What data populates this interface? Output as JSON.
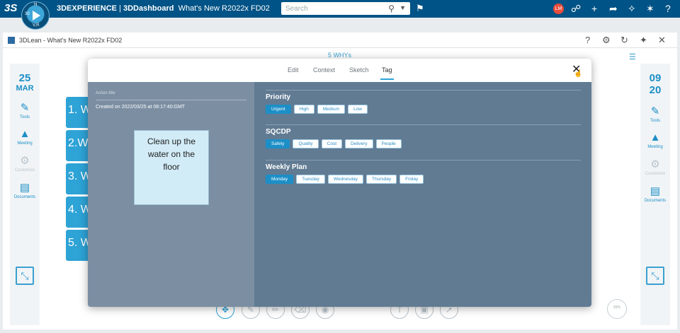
{
  "topbar": {
    "logo": "3S",
    "compass": {
      "north": "N",
      "left": "30",
      "vr": "V,R"
    },
    "app_name": "3DEXPERIENCE",
    "dashboard": "3DDashboard",
    "dashboard_title": "What's New R2022x FD02",
    "search_placeholder": "Search",
    "avatar": "LM"
  },
  "widget": {
    "title": "3DLean - What's New R2022x FD02",
    "board_title": "5 WHYs"
  },
  "left_sidebar": {
    "day": "25",
    "month": "MAR",
    "items": [
      {
        "label": "Tools",
        "icon": "tools-icon"
      },
      {
        "label": "Meeting",
        "icon": "meeting-icon"
      },
      {
        "label": "Customize",
        "icon": "customize-icon"
      },
      {
        "label": "Documents",
        "icon": "documents-icon"
      }
    ]
  },
  "right_sidebar": {
    "day": "09",
    "month": "20",
    "items": [
      {
        "label": "Tools",
        "icon": "tools-icon"
      },
      {
        "label": "Meeting",
        "icon": "meeting-icon"
      },
      {
        "label": "Customize",
        "icon": "customize-icon"
      },
      {
        "label": "Documents",
        "icon": "documents-icon"
      }
    ]
  },
  "whys": [
    "1. W",
    "2.Wh",
    "3. W",
    "4. W",
    "5. W"
  ],
  "zoom_label": "55%",
  "modal": {
    "tabs": [
      "Edit",
      "Context",
      "Sketch",
      "Tag"
    ],
    "active_tab": "Tag",
    "action_title_label": "Action title",
    "created": "Created on 2022/03/25 at 08:17:40:GMT",
    "sticky_text": "Clean up the water on the floor",
    "sections": {
      "priority": {
        "label": "Priority",
        "options": [
          "Urgent",
          "High",
          "Medium",
          "Low"
        ],
        "selected": "Urgent"
      },
      "sqcdp": {
        "label": "SQCDP",
        "options": [
          "Safety",
          "Quality",
          "Cost",
          "Delivery",
          "People"
        ],
        "selected": "Safety"
      },
      "weekly": {
        "label": "Weekly Plan",
        "options": [
          "Monday",
          "Tuesday",
          "Wednesday",
          "Thursday",
          "Friday"
        ],
        "selected": "Monday"
      }
    }
  },
  "colors": {
    "topbar": "#005386",
    "accent": "#1c8fc7",
    "modal_bg": "#617b93"
  }
}
